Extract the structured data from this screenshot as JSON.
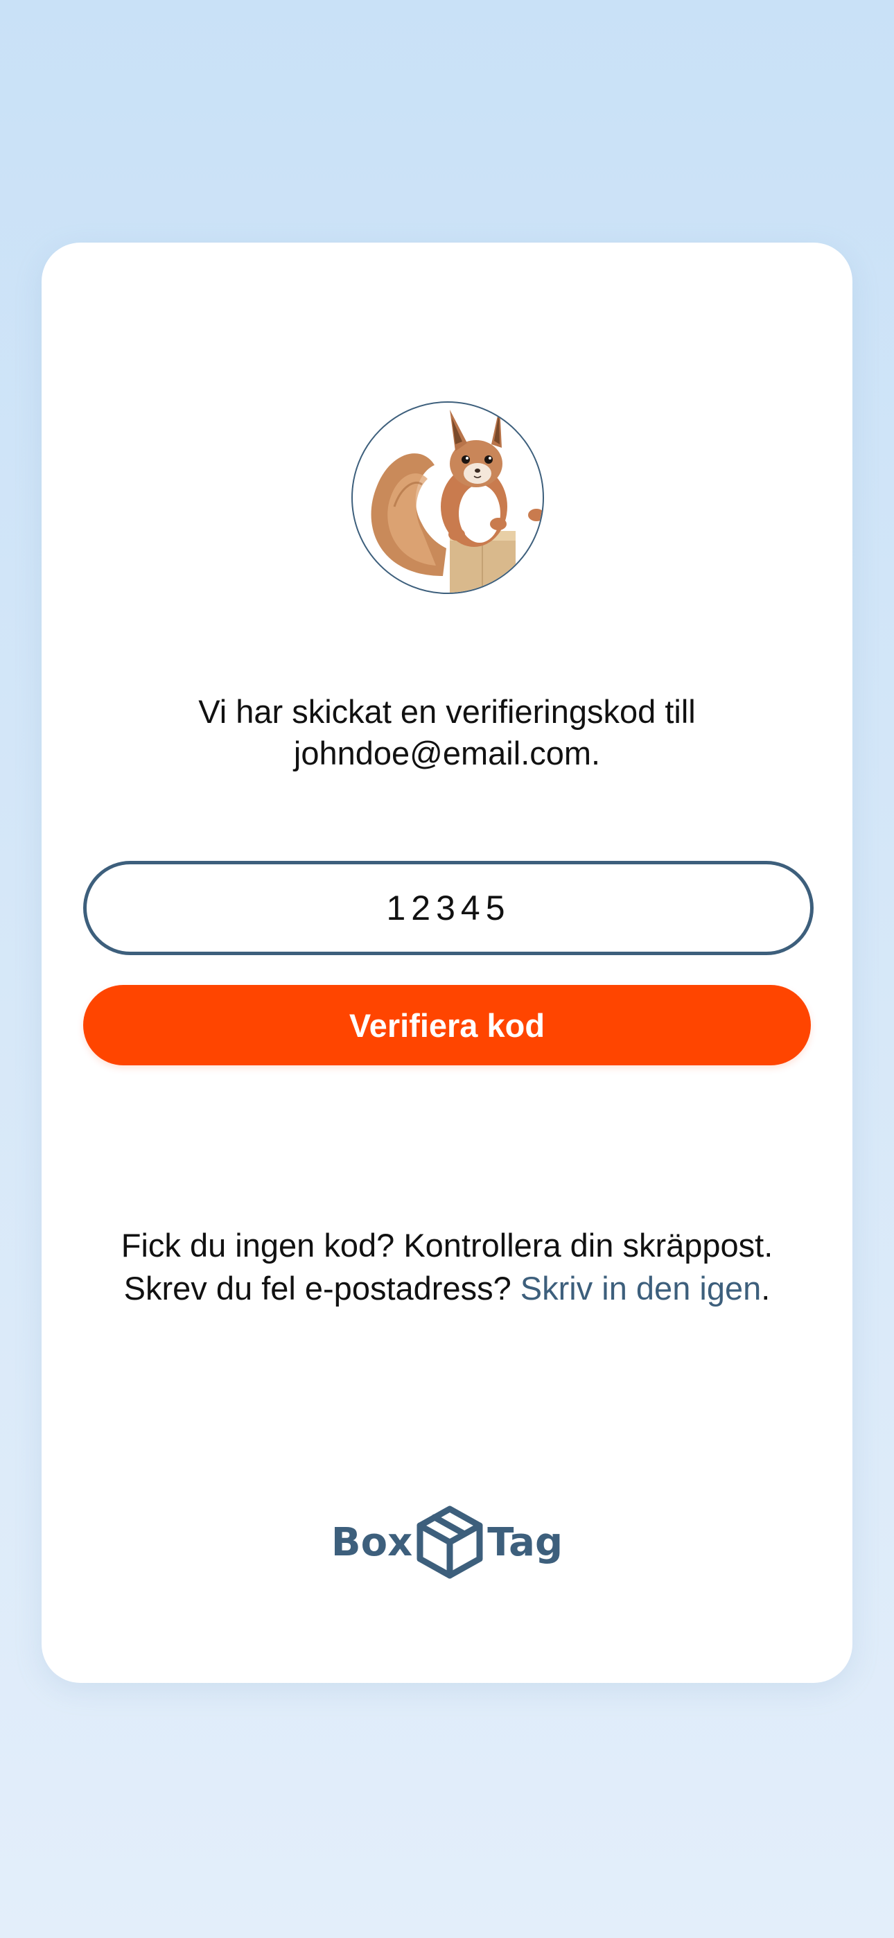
{
  "verification": {
    "message_line1": "Vi har skickat en verifieringskod till",
    "message_line2": "johndoe@email.com.",
    "code_value": "12345",
    "verify_button_label": "Verifiera kod"
  },
  "help": {
    "line1": "Fick du ingen kod? Kontrollera din skräppost.",
    "line2_prefix": "Skrev du fel e-postadress? ",
    "reenter_link": "Skriv in den igen",
    "line2_suffix": "."
  },
  "brand": {
    "logo_left": "Box",
    "logo_right": "Tag",
    "logo_icon": "box-icon",
    "avatar_icon": "squirrel-avatar",
    "brand_color": "#3d5f7c",
    "accent_color": "#ff4500"
  }
}
